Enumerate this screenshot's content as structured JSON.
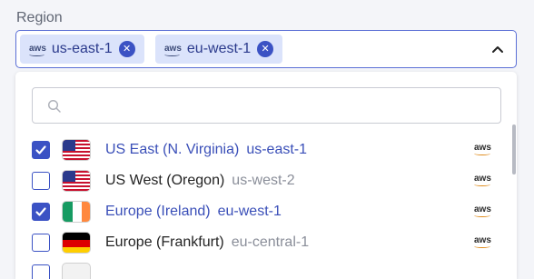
{
  "field": {
    "label": "Region"
  },
  "selected_chips": [
    {
      "icon": "aws",
      "label": "us-east-1",
      "remove_icon": "close-circle-icon"
    },
    {
      "icon": "aws",
      "label": "eu-west-1",
      "remove_icon": "close-circle-icon"
    }
  ],
  "toggle_icon": "chevron-up-icon",
  "search": {
    "placeholder": "",
    "value": "",
    "icon": "search-icon"
  },
  "options": [
    {
      "name": "US East (N. Virginia)",
      "code": "us-east-1",
      "checked": true,
      "flag": "us-flag",
      "provider": "aws"
    },
    {
      "name": "US West (Oregon)",
      "code": "us-west-2",
      "checked": false,
      "flag": "us-flag",
      "provider": "aws"
    },
    {
      "name": "Europe (Ireland)",
      "code": "eu-west-1",
      "checked": true,
      "flag": "ireland-flag",
      "provider": "aws"
    },
    {
      "name": "Europe (Frankfurt)",
      "code": "eu-central-1",
      "checked": false,
      "flag": "germany-flag",
      "provider": "aws"
    }
  ],
  "colors": {
    "accent": "#3b52c4",
    "chip_bg": "#dbe3fb",
    "selected_text": "#3a4fb8"
  }
}
